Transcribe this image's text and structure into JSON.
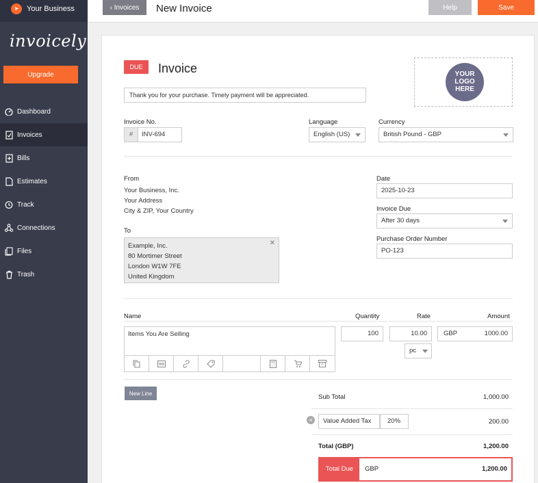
{
  "sidebar": {
    "brand": "Your Business",
    "wordmark": "invoicely",
    "upgrade": "Upgrade",
    "items": [
      {
        "label": "Dashboard",
        "icon": "dashboard-icon"
      },
      {
        "label": "Invoices",
        "icon": "invoice-icon"
      },
      {
        "label": "Bills",
        "icon": "bill-icon"
      },
      {
        "label": "Estimates",
        "icon": "estimate-icon"
      },
      {
        "label": "Track",
        "icon": "clock-icon"
      },
      {
        "label": "Connections",
        "icon": "connections-icon"
      },
      {
        "label": "Files",
        "icon": "files-icon"
      },
      {
        "label": "Trash",
        "icon": "trash-icon"
      }
    ]
  },
  "topbar": {
    "back": "Invoices",
    "title": "New Invoice",
    "help": "Help",
    "save": "Save"
  },
  "invoice": {
    "status": "DUE",
    "title": "Invoice",
    "message": "Thank you for your purchase. Timely payment will be appreciated.",
    "logo_text": "YOUR LOGO HERE",
    "number_label": "Invoice No.",
    "number_prefix": "#",
    "number": "INV-694",
    "language_label": "Language",
    "language": "English (US)",
    "currency_label": "Currency",
    "currency": "British Pound - GBP",
    "from_label": "From",
    "from": [
      "Your Business, Inc.",
      "Your Address",
      "City & ZIP, Your Country"
    ],
    "to_label": "To",
    "to": [
      "Example, Inc.",
      "80 Mortimer Street",
      "London W1W 7FE",
      "United Kingdom"
    ],
    "date_label": "Date",
    "date": "2025-10-23",
    "due_label": "Invoice Due",
    "due": "After 30 days",
    "po_label": "Purchase Order Number",
    "po": "PO-123"
  },
  "items": {
    "headers": {
      "name": "Name",
      "quantity": "Quantity",
      "rate": "Rate",
      "amount": "Amount"
    },
    "rows": [
      {
        "name": "Items You Are Selling",
        "quantity": "100",
        "rate": "10.00",
        "unit": "pc",
        "currency": "GBP",
        "amount": "1000.00"
      }
    ],
    "new_line": "New Line"
  },
  "totals": {
    "subtotal_label": "Sub Total",
    "subtotal": "1,000.00",
    "tax_label": "Value Added Tax",
    "tax_rate": "20%",
    "tax": "200.00",
    "total_label": "Total (GBP)",
    "total": "1,200.00",
    "due_label": "Total Due",
    "due_currency": "GBP",
    "due": "1,200.00"
  },
  "colors": {
    "accent": "#f86a2d",
    "danger": "#ea5455",
    "sidebar": "#383c4b"
  }
}
